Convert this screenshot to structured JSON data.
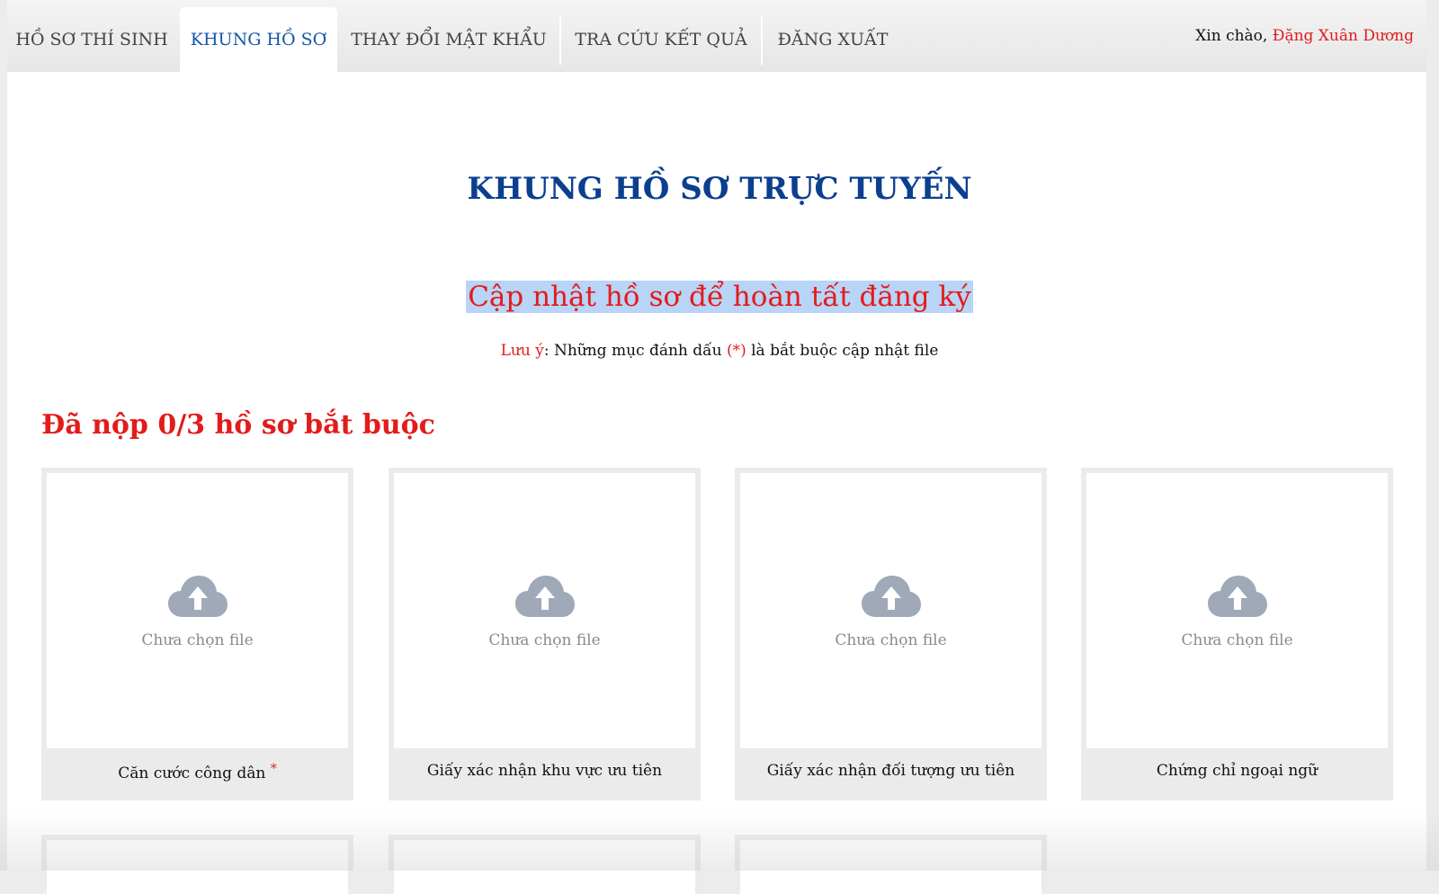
{
  "nav": {
    "tabs": [
      {
        "label": "HỒ SƠ THÍ SINH"
      },
      {
        "label": "KHUNG HỒ SƠ"
      },
      {
        "label": "THAY ĐỔI MẬT KHẨU"
      },
      {
        "label": "TRA CỨU KẾT QUẢ"
      },
      {
        "label": "ĐĂNG XUẤT"
      }
    ],
    "active_tab": "KHUNG HỒ SƠ",
    "greeting_prefix": "Xin chào,",
    "user_name": "Đặng Xuân Dương"
  },
  "page": {
    "title": "KHUNG HỒ SƠ TRỰC TUYẾN",
    "subtitle": "Cập nhật hồ sơ để hoàn tất đăng ký",
    "note_label": "Lưu ý",
    "note_text_1": ": Những mục đánh dấu ",
    "note_mark": "(*)",
    "note_text_2": " là bắt buộc cập nhật file",
    "required_count": "Đã nộp 0/3 hồ sơ bắt buộc"
  },
  "cards": [
    {
      "label": "Căn cước công dân",
      "required_mark": "*",
      "status": "Chưa chọn file",
      "icon": "cloud-upload-icon"
    },
    {
      "label": "Giấy xác nhận khu vực ưu tiên",
      "status": "Chưa chọn file",
      "icon": "cloud-upload-icon"
    },
    {
      "label": "Giấy xác nhận đối tượng ưu tiên",
      "status": "Chưa chọn file",
      "icon": "cloud-upload-icon"
    },
    {
      "label": "Chứng chỉ ngoại ngữ",
      "status": "Chưa chọn file",
      "icon": "cloud-upload-icon"
    }
  ],
  "colors": {
    "accent_blue": "#1556a8",
    "title_blue": "#0b3f8f",
    "alert_red": "#e31b1b",
    "highlight": "#b8d4f6",
    "icon_gray": "#9fa9b8"
  }
}
